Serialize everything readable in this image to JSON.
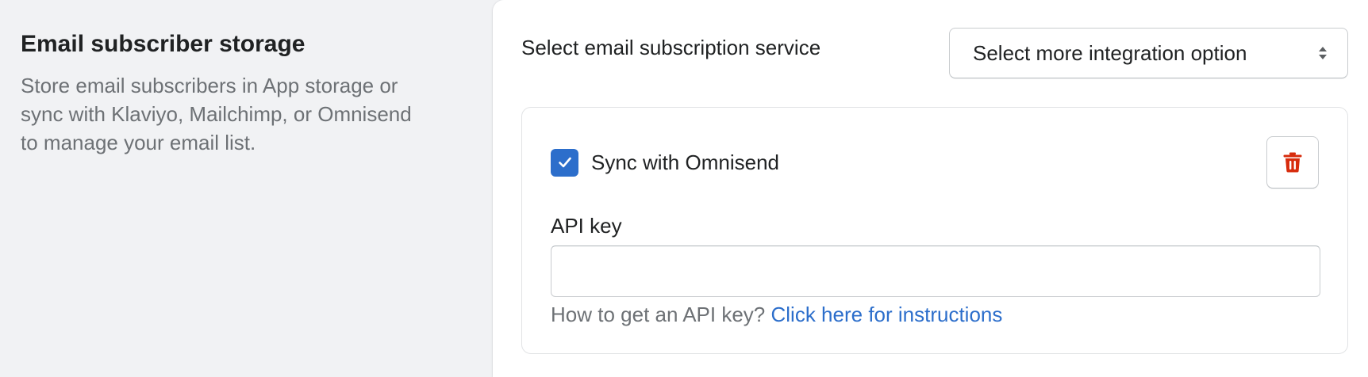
{
  "section": {
    "title": "Email subscriber storage",
    "description": "Store email subscribers in App storage or sync with Klaviyo, Mailchimp, or Omnisend to manage your email list."
  },
  "service": {
    "label": "Select email subscription service",
    "select_value": "Select more integration option",
    "select_icon": "select-arrows-icon"
  },
  "integration": {
    "checkbox_label": "Sync with Omnisend",
    "checked": true,
    "delete_icon": "trash-icon",
    "api_key_label": "API key",
    "api_key_value": "",
    "help_prefix": "How to get an API key? ",
    "help_link": "Click here for instructions"
  },
  "colors": {
    "accent": "#2c6ecb",
    "danger": "#d72c0d",
    "subdued_text": "#6d7175",
    "background": "#f1f2f4"
  }
}
